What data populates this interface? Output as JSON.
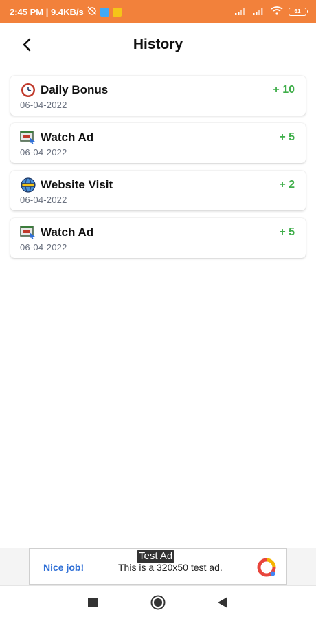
{
  "status_bar": {
    "time_speed": "2:45 PM | 9.4KB/s",
    "battery": "61"
  },
  "header": {
    "title": "History"
  },
  "history": [
    {
      "title": "Daily Bonus",
      "date": "06-04-2022",
      "points": "+ 10",
      "icon": "clock-icon"
    },
    {
      "title": "Watch Ad",
      "date": "06-04-2022",
      "points": "+ 5",
      "icon": "video-ad-icon"
    },
    {
      "title": "Website Visit",
      "date": "06-04-2022",
      "points": "+ 2",
      "icon": "globe-icon"
    },
    {
      "title": "Watch Ad",
      "date": "06-04-2022",
      "points": "+ 5",
      "icon": "video-ad-icon"
    }
  ],
  "ad": {
    "label": "Test Ad",
    "cta": "Nice job!",
    "text": "This is a 320x50 test ad."
  },
  "colors": {
    "status_bar": "#f2813b",
    "points": "#3fae4a",
    "ad_link": "#2f6fd6"
  }
}
